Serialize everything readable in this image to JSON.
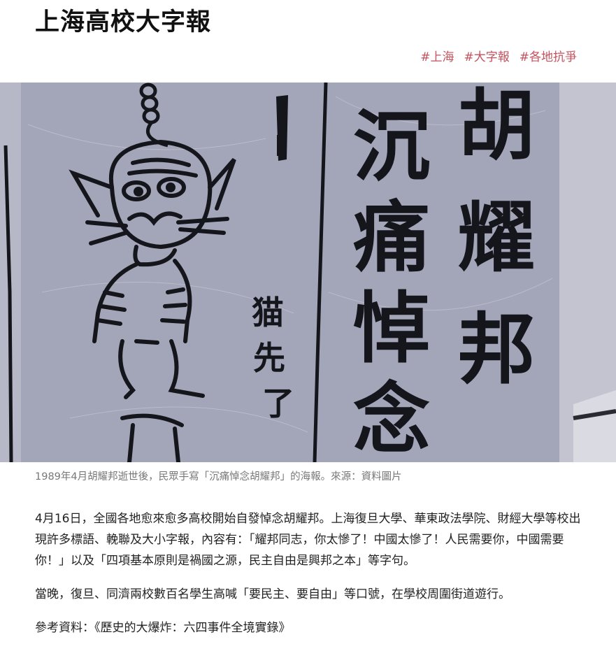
{
  "page": {
    "title": "上海高校大字報"
  },
  "tags": [
    {
      "label": "#上海"
    },
    {
      "label": "#大字報"
    },
    {
      "label": "#各地抗爭"
    }
  ],
  "figure": {
    "image_text_left": "猫先了",
    "image_text_col1": "沉痛悼念",
    "image_text_col2": "胡耀邦",
    "caption": "1989年4月胡耀邦逝世後，民眾手寫「沉痛悼念胡耀邦」的海報。來源：資料圖片"
  },
  "article": {
    "paragraphs": [
      "4月16日，全國各地愈來愈多高校開始自發悼念胡耀邦。上海復旦大學、華東政法學院、財經大學等校出現許多標語、輓聯及大小字報，內容有：「耀邦同志，你太慘了！中國太慘了！人民需要你，中國需要你！」以及「四項基本原則是禍國之源，民主自由是興邦之本」等字句。",
      "當晚，復旦、同濟兩校數百名學生高喊「要民主、要自由」等口號，在學校周圍街道遊行。"
    ],
    "reference": "參考資料：《歷史的大爆炸：六四事件全境實錄》"
  }
}
